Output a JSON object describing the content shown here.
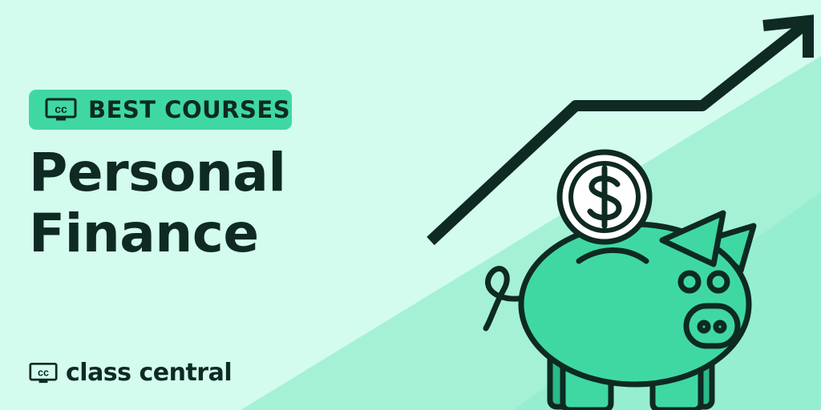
{
  "badge": {
    "icon": "cc-logo-icon",
    "label": "BEST COURSES",
    "color": "#3fd8a3"
  },
  "headline": {
    "line1": "Personal",
    "line2": "Finance"
  },
  "brand": {
    "icon": "cc-logo-icon",
    "name": "class central"
  },
  "illustration": {
    "icons": [
      "growth-arrow-icon",
      "coin-icon",
      "dollar-sign-icon",
      "piggy-bank-icon"
    ],
    "coin_symbol": "$"
  },
  "colors": {
    "background": "#d3fcef",
    "accent": "#3fd8a3",
    "ink": "#0e2a22"
  }
}
